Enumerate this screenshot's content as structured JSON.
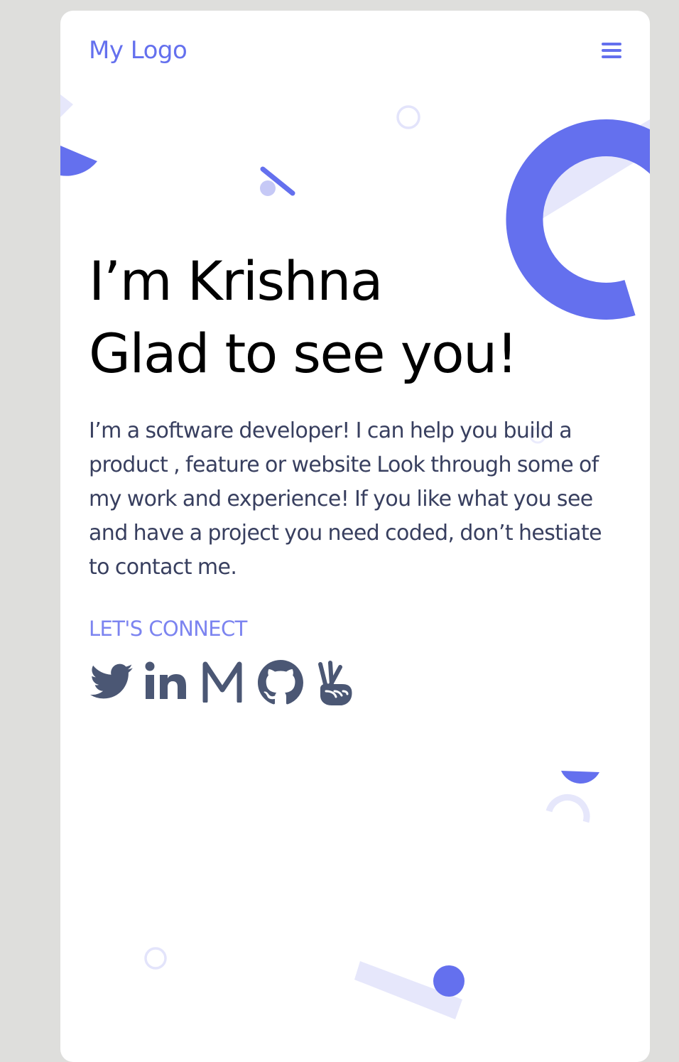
{
  "header": {
    "logo_text": "My Logo",
    "menu_icon": "hamburger-menu-icon"
  },
  "hero": {
    "headline_line1": "I’m Krishna",
    "headline_line2": "Glad to see you!",
    "intro": "I’m a software developer! I can help you build a product , feature or website Look through some of my work and experience! If you like what you see and have a project you need coded, don’t hestiate to contact me."
  },
  "connect": {
    "label": "LET'S CONNECT",
    "links": [
      {
        "icon": "twitter-icon"
      },
      {
        "icon": "linkedin-icon"
      },
      {
        "icon": "medium-icon"
      },
      {
        "icon": "github-icon"
      },
      {
        "icon": "angellist-icon"
      }
    ]
  },
  "colors": {
    "accent": "#6470ee",
    "accent_light": "#e6e7fb",
    "text_dark": "#000000",
    "text_body": "#383f5f",
    "icon_gray": "#4b5774",
    "page_background": "#dededc",
    "card_background": "#ffffff"
  }
}
